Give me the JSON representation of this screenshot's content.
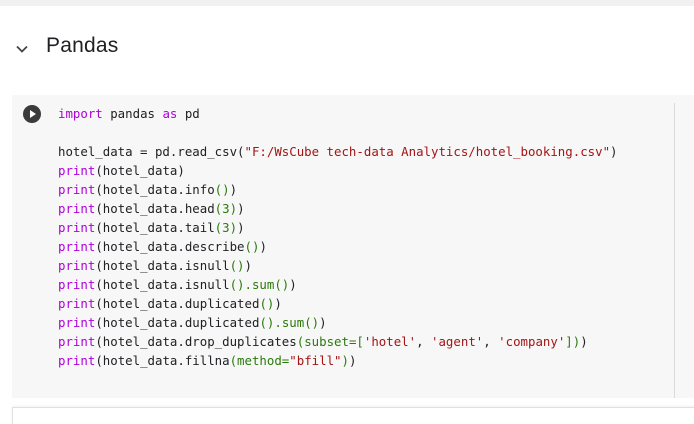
{
  "section": {
    "title": "Pandas",
    "chevron_icon": "chevron-down-icon"
  },
  "cell": {
    "run_icon": "play-icon",
    "code_lines": [
      [
        {
          "t": "import",
          "c": "kw"
        },
        {
          "t": " pandas "
        },
        {
          "t": "as",
          "c": "kw"
        },
        {
          "t": " pd"
        }
      ],
      [],
      [
        {
          "t": "hotel_data = pd.read_csv("
        },
        {
          "t": "\"F:/WsCube tech-data Analytics/hotel_booking.csv\"",
          "c": "str"
        },
        {
          "t": ")"
        }
      ],
      [
        {
          "t": "print",
          "c": "kw"
        },
        {
          "t": "(hotel_data)"
        }
      ],
      [
        {
          "t": "print",
          "c": "kw"
        },
        {
          "t": "(hotel_data.info"
        },
        {
          "t": "()",
          "c": "paren"
        },
        {
          "t": ")"
        }
      ],
      [
        {
          "t": "print",
          "c": "kw"
        },
        {
          "t": "(hotel_data.head"
        },
        {
          "t": "(3)",
          "c": "paren"
        },
        {
          "t": ")"
        }
      ],
      [
        {
          "t": "print",
          "c": "kw"
        },
        {
          "t": "(hotel_data.tail"
        },
        {
          "t": "(3)",
          "c": "paren"
        },
        {
          "t": ")"
        }
      ],
      [
        {
          "t": "print",
          "c": "kw"
        },
        {
          "t": "(hotel_data.describe"
        },
        {
          "t": "()",
          "c": "paren"
        },
        {
          "t": ")"
        }
      ],
      [
        {
          "t": "print",
          "c": "kw"
        },
        {
          "t": "(hotel_data.isnull"
        },
        {
          "t": "()",
          "c": "paren"
        },
        {
          "t": ")"
        }
      ],
      [
        {
          "t": "print",
          "c": "kw"
        },
        {
          "t": "(hotel_data.isnull"
        },
        {
          "t": "().sum()",
          "c": "paren"
        },
        {
          "t": ")"
        }
      ],
      [
        {
          "t": "print",
          "c": "kw"
        },
        {
          "t": "(hotel_data.duplicated"
        },
        {
          "t": "()",
          "c": "paren"
        },
        {
          "t": ")"
        }
      ],
      [
        {
          "t": "print",
          "c": "kw"
        },
        {
          "t": "(hotel_data.duplicated"
        },
        {
          "t": "().sum()",
          "c": "paren"
        },
        {
          "t": ")"
        }
      ],
      [
        {
          "t": "print",
          "c": "kw"
        },
        {
          "t": "(hotel_data.drop_duplicates"
        },
        {
          "t": "(subset=[",
          "c": "paren"
        },
        {
          "t": "'hotel'",
          "c": "str"
        },
        {
          "t": ", "
        },
        {
          "t": "'agent'",
          "c": "str"
        },
        {
          "t": ", "
        },
        {
          "t": "'company'",
          "c": "str"
        },
        {
          "t": "])",
          "c": "paren"
        },
        {
          "t": ")"
        }
      ],
      [
        {
          "t": "print",
          "c": "kw"
        },
        {
          "t": "(hotel_data.fillna"
        },
        {
          "t": "(method=",
          "c": "paren"
        },
        {
          "t": "\"bfill\"",
          "c": "str"
        },
        {
          "t": ")",
          "c": "paren"
        },
        {
          "t": ")"
        }
      ]
    ]
  },
  "colors": {
    "keyword": "#af00db",
    "string": "#a31515",
    "paren": "#2b7a0b",
    "cell_bg": "#f7f7f7"
  }
}
